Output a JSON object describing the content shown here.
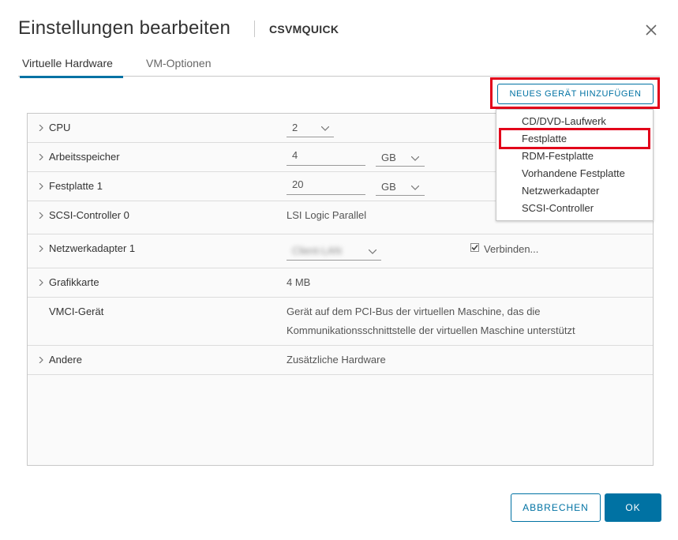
{
  "dialog": {
    "title": "Einstellungen bearbeiten",
    "vm_name": "CSVMQUICK",
    "close_icon": "close-icon"
  },
  "tabs": [
    {
      "label": "Virtuelle Hardware",
      "active": true
    },
    {
      "label": "VM-Optionen",
      "active": false
    }
  ],
  "add_device_button": "NEUES GERÄT HINZUFÜGEN",
  "add_device_menu": {
    "items": [
      "CD/DVD-Laufwerk",
      "Festplatte",
      "RDM-Festplatte",
      "Vorhandene Festplatte",
      "Netzwerkadapter",
      "SCSI-Controller"
    ],
    "highlighted": "Festplatte"
  },
  "hardware": {
    "cpu": {
      "label": "CPU",
      "value": "2"
    },
    "memory": {
      "label": "Arbeitsspeicher",
      "value": "4",
      "unit": "GB"
    },
    "disk": {
      "label": "Festplatte 1",
      "value": "20",
      "unit": "GB"
    },
    "scsi": {
      "label": "SCSI-Controller 0",
      "value": "LSI Logic Parallel"
    },
    "network": {
      "label": "Netzwerkadapter 1",
      "value": "Client-LAN",
      "connect_label": "Verbinden...",
      "connect_checked": true
    },
    "graphics": {
      "label": "Grafikkarte",
      "value": "4 MB"
    },
    "vmci": {
      "label": "VMCI-Gerät",
      "line1": "Gerät auf dem PCI-Bus der virtuellen Maschine, das die",
      "line2": "Kommunikationsschnittstelle der virtuellen Maschine unterstützt"
    },
    "other": {
      "label": "Andere",
      "value": "Zusätzliche Hardware"
    }
  },
  "footer": {
    "cancel_label": "ABBRECHEN",
    "ok_label": "OK"
  },
  "colors": {
    "accent": "#0072a3",
    "highlight": "#e2001a"
  }
}
